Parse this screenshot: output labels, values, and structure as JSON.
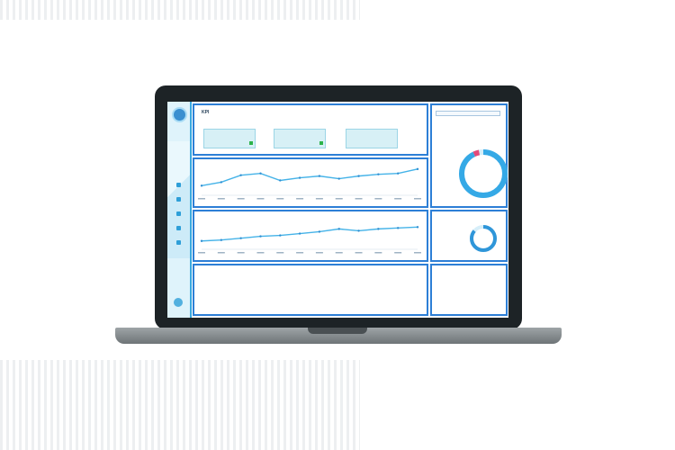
{
  "dashboard": {
    "title": "KPI",
    "subtitle": "",
    "kpis": [
      {
        "caption": "",
        "value": "",
        "trend": "up"
      },
      {
        "caption": "",
        "value": "",
        "trend": "up"
      },
      {
        "caption": "",
        "value": "",
        "trend": "none"
      }
    ],
    "chart1_title": "",
    "chart2_title": "",
    "right_panel": {
      "search_placeholder": "",
      "donut1_title": "",
      "donut1_value": "",
      "donut2_title": "",
      "donut2_value": ""
    }
  },
  "colors": {
    "accent": "#2d7fd6",
    "line": "#45b3e8",
    "kpi_bg": "#d7f0f6",
    "up": "#2db34a",
    "device": "#1d2326"
  },
  "chart_data": [
    {
      "type": "line",
      "x": [
        "1",
        "2",
        "3",
        "4",
        "5",
        "6",
        "7",
        "8",
        "9",
        "10",
        "11",
        "12"
      ],
      "series": [
        {
          "values": [
            22,
            30,
            46,
            50,
            34,
            40,
            44,
            38,
            44,
            48,
            50,
            60
          ]
        }
      ]
    },
    {
      "type": "line",
      "x": [
        "1",
        "2",
        "3",
        "4",
        "5",
        "6",
        "7",
        "8",
        "9",
        "10",
        "11",
        "12"
      ],
      "series": [
        {
          "values": [
            18,
            20,
            24,
            28,
            30,
            34,
            38,
            44,
            40,
            44,
            46,
            48
          ]
        }
      ]
    }
  ]
}
